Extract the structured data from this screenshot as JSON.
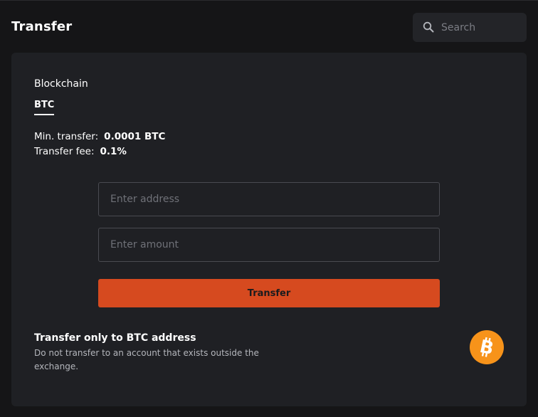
{
  "header": {
    "title": "Transfer",
    "search": {
      "placeholder": "Search",
      "value": ""
    }
  },
  "card": {
    "blockchain_label": "Blockchain",
    "tabs": [
      {
        "label": "BTC",
        "active": true
      }
    ],
    "min_transfer": {
      "label": "Min. transfer:",
      "value": "0.0001 BTC"
    },
    "transfer_fee": {
      "label": "Transfer fee:",
      "value": "0.1%"
    },
    "address_field": {
      "placeholder": "Enter address",
      "value": ""
    },
    "amount_field": {
      "placeholder": "Enter amount",
      "value": ""
    },
    "transfer_button_label": "Transfer",
    "notice": {
      "title": "Transfer only to BTC address",
      "text": "Do not transfer to an account that exists outside the exchange."
    },
    "coin_icon": "bitcoin-icon"
  },
  "colors": {
    "background": "#151517",
    "card": "#1f2024",
    "accent": "#d64a1f",
    "bitcoin": "#f7931a",
    "muted_text": "#b4b6bc"
  }
}
